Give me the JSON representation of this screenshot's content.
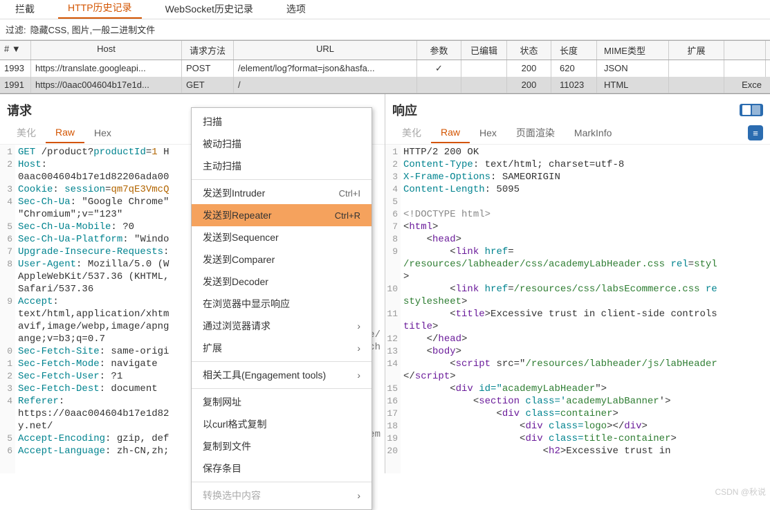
{
  "topTabs": {
    "t0": "拦截",
    "t1": "HTTP历史记录",
    "t2": "WebSocket历史记录",
    "t3": "选项"
  },
  "filter": {
    "label": "过滤:",
    "value": "隐藏CSS, 图片,一般二进制文件"
  },
  "cols": {
    "c0": "# ▼",
    "c1": "Host",
    "c2": "请求方法",
    "c3": "URL",
    "c4": "参数",
    "c5": "已编辑",
    "c6": "状态",
    "c7": "长度",
    "c8": "MIME类型",
    "c9": "扩展",
    "c10": ""
  },
  "rows": {
    "r0": {
      "id": "1993",
      "host": "https://translate.googleapi...",
      "method": "POST",
      "url": "/element/log?format=json&hasfa...",
      "params": "✓",
      "edited": "",
      "status": "200",
      "len": "620",
      "mime": "JSON",
      "ext": ""
    },
    "r1": {
      "id": "1991",
      "host": "https://0aac004604b17e1d...",
      "method": "GET",
      "url": "/",
      "params": "",
      "edited": "",
      "status": "200",
      "len": "11023",
      "mime": "HTML",
      "ext": "Exce"
    }
  },
  "req": {
    "title": "请求",
    "tab0": "美化",
    "tab1": "Raw",
    "tab2": "Hex",
    "ln": {
      "l1": "1",
      "l2": "2",
      "l3": "3",
      "l4": "4",
      "l5": "5",
      "l6": "6",
      "l7": "7",
      "l8": "8",
      "l9": "9",
      "l10": "0",
      "l11": "1",
      "l12": "2",
      "l13": "3",
      "l14": "4",
      "l15": "5",
      "l16": "6"
    },
    "l1a": "GET",
    "l1b": "/product?",
    "l1c": "productId",
    "l1d": "=",
    "l1e": "1",
    "l1f": " H",
    "l2a": "Host",
    "l2b": ": ",
    "l2c": "0aac004604b17e1d82206ada00",
    "l3a": "Cookie",
    "l3b": ": ",
    "l3c": "session",
    "l3d": "=",
    "l3e": "qm7qE3VmcQ",
    "l4a": "Sec-Ch-Ua",
    "l4b": ": \"Google Chrome\"",
    "l4c": "\"Chromium\";v=\"123\"",
    "l5a": "Sec-Ch-Ua-Mobile",
    "l5b": ": ?0",
    "l6a": "Sec-Ch-Ua-Platform",
    "l6b": ": \"Windo",
    "l7a": "Upgrade-Insecure-Requests",
    "l7b": ":",
    "l8a": "User-Agent",
    "l8b": ": Mozilla/5.0 (W",
    "l8c": "AppleWebKit/537.36 (KHTML,",
    "l8d": "Safari/537.36",
    "l9a": "Accept",
    "l9b": ": ",
    "l9c": "text/html,application/xhtm",
    "l9d": "avif,image/webp,image/apng",
    "l9e": "ange;v=b3;q=0.7",
    "l10a": "Sec-Fetch-Site",
    "l10b": ": same-origi",
    "l11a": "Sec-Fetch-Mode",
    "l11b": ": navigate",
    "l12a": "Sec-Fetch-User",
    "l12b": ": ?1",
    "l13a": "Sec-Fetch-Dest",
    "l13b": ": document",
    "l14a": "Referer",
    "l14b": ": ",
    "l14c": "https://0aac004604b17e1d82",
    "l14d": "y.net/",
    "l15a": "Accept-Encoding",
    "l15b": ": gzip, def",
    "l16a": "Accept-Language",
    "l16b": ": zh-CN,zh;"
  },
  "bg": {
    "b1": "ge/",
    "b2": "xch",
    "b3": "dem"
  },
  "resp": {
    "title": "响应",
    "tab0": "美化",
    "tab1": "Raw",
    "tab2": "Hex",
    "tab3": "页面渲染",
    "tab4": "MarkInfo",
    "ln": {
      "l1": "1",
      "l2": "2",
      "l3": "3",
      "l4": "4",
      "l5": "5",
      "l6": "6",
      "l7": "7",
      "l8": "8",
      "l9": "9",
      "l10": "10",
      "l11": "11",
      "l12": "12",
      "l13": "13",
      "l14": "14",
      "l15": "15",
      "l16": "16",
      "l17": "17",
      "l18": "18",
      "l19": "19",
      "l20": "20"
    },
    "l1": "HTTP/2 200 OK",
    "l2a": "Content-Type",
    "l2b": ": text/html; charset=utf-8",
    "l3a": "X-Frame-Options",
    "l3b": ": SAMEORIGIN",
    "l4a": "Content-Length",
    "l4b": ": 5095",
    "l6": "<!DOCTYPE html>",
    "l7a": "<",
    "l7b": "html",
    "l7c": ">",
    "l8a": "    <",
    "l8b": "head",
    "l8c": ">",
    "l9a": "        <",
    "l9b": "link",
    "l9c": " href",
    "l9d": "=",
    "l9e": "/resources/labheader/css/academyLabHeader.css",
    "l9f": " rel",
    "l9g": "=",
    "l9h": "styl",
    "l9i": ">",
    "l10a": "        <",
    "l10b": "link",
    "l10c": " href",
    "l10d": "=",
    "l10e": "/resources/css/labsEcommerce.css",
    "l10f": " re",
    "l10g": "stylesheet",
    "l10h": ">",
    "l11a": "        <",
    "l11b": "title",
    "l11c": ">",
    "l11d": "Excessive trust in client-side controls",
    "l11e": "title",
    "l11f": ">",
    "l12a": "    </",
    "l12b": "head",
    "l12c": ">",
    "l13a": "    <",
    "l13b": "body",
    "l13c": ">",
    "l14a": "        <",
    "l14b": "script",
    "l14c": " src=\"",
    "l14d": "/resources/labheader/js/labHeader",
    "l14e": "</",
    "l14f": "script",
    "l14g": ">",
    "l15a": "        <",
    "l15b": "div",
    "l15c": " id=\"",
    "l15d": "academyLabHeader",
    "l15e": "\">",
    "l16a": "            <",
    "l16b": "section",
    "l16c": " class='",
    "l16d": "academyLabBanner",
    "l16e": "'>",
    "l17a": "                <",
    "l17b": "div",
    "l17c": " class=",
    "l17d": "container",
    "l17e": ">",
    "l18a": "                    <",
    "l18b": "div",
    "l18c": " class=",
    "l18d": "logo",
    "l18e": "></",
    "l18f": "div",
    "l18g": ">",
    "l19a": "                    <",
    "l19b": "div",
    "l19c": " class=",
    "l19d": "title-container",
    "l19e": ">",
    "l20a": "                        <",
    "l20b": "h2",
    "l20c": ">",
    "l20d": "Excessive trust in"
  },
  "menu": {
    "m0": "扫描",
    "m1": "被动扫描",
    "m2": "主动扫描",
    "m3": "发送到Intruder",
    "m3s": "Ctrl+I",
    "m4": "发送到Repeater",
    "m4s": "Ctrl+R",
    "m5": "发送到Sequencer",
    "m6": "发送到Comparer",
    "m7": "发送到Decoder",
    "m8": "在浏览器中显示响应",
    "m9": "通过浏览器请求",
    "m10": "扩展",
    "m11": "相关工具(Engagement tools)",
    "m12": "复制网址",
    "m13": "以curl格式复制",
    "m14": "复制到文件",
    "m15": "保存条目",
    "m16": "转换选中内容"
  },
  "watermark": "CSDN @秋说"
}
